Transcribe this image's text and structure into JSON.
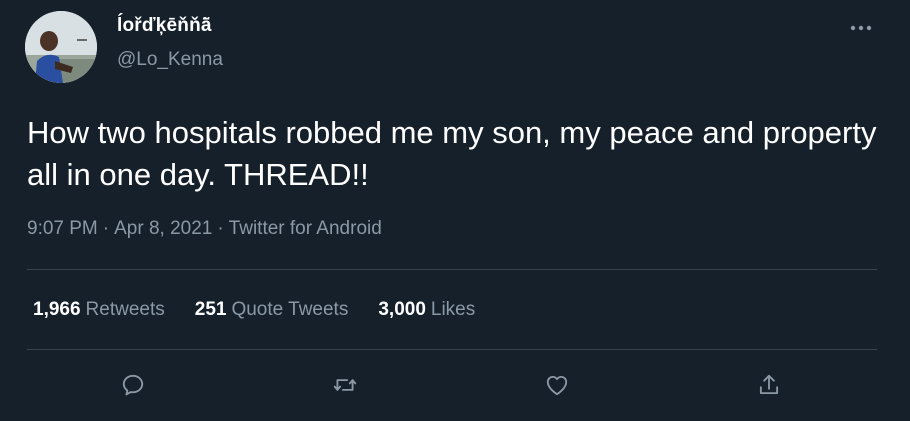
{
  "user": {
    "display_name": "ĺořďķēňňā̃",
    "handle": "@Lo_Kenna",
    "avatar_icon": "user-avatar-photo"
  },
  "tweet": {
    "text": "How two hospitals robbed me my son, my peace and property all in one day. THREAD!!",
    "time": "9:07 PM",
    "date": "Apr 8, 2021",
    "separator": "·",
    "source": "Twitter for Android"
  },
  "stats": {
    "retweets_count": "1,966",
    "retweets_label": "Retweets",
    "quotes_count": "251",
    "quotes_label": "Quote Tweets",
    "likes_count": "3,000",
    "likes_label": "Likes"
  },
  "icons": {
    "more": "more-horizontal-icon",
    "reply": "reply-icon",
    "retweet": "retweet-icon",
    "like": "heart-icon",
    "share": "share-icon"
  },
  "colors": {
    "background": "#15202b",
    "primary_text": "#ffffff",
    "secondary_text": "#8b98a5",
    "divider": "#38444d"
  }
}
